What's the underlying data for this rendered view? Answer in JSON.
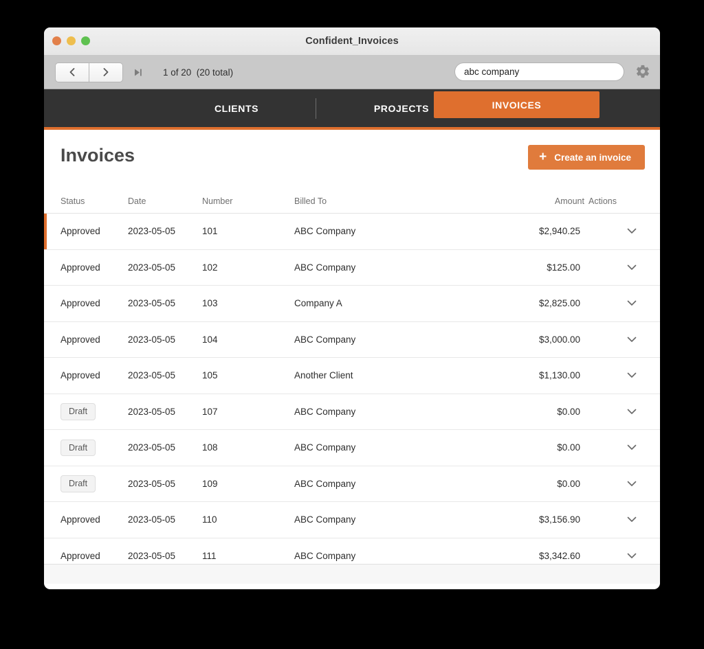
{
  "window": {
    "title": "Confident_Invoices",
    "traffic_lights": [
      {
        "name": "close",
        "color": "#e2804a"
      },
      {
        "name": "minimize",
        "color": "#eebe4e"
      },
      {
        "name": "maximize",
        "color": "#5fc150"
      }
    ]
  },
  "toolbar": {
    "back_icon": "chevron-left-icon",
    "forward_icon": "chevron-right-icon",
    "skip_icon": "skip-to-end-icon",
    "page_counter": "1 of 20  (20 total)",
    "search_value": "abc company",
    "search_placeholder": "",
    "settings_icon": "gear-icon"
  },
  "nav": {
    "tabs": [
      {
        "label": "CLIENTS",
        "active": false
      },
      {
        "label": "PROJECTS",
        "active": false
      },
      {
        "label": "INVOICES",
        "active": true
      }
    ],
    "accent_color": "#df6f2e",
    "bar_color": "#333333"
  },
  "page": {
    "title": "Invoices",
    "create_button": "Create an invoice",
    "create_icon": "plus-icon"
  },
  "table": {
    "columns": [
      "Status",
      "Date",
      "Number",
      "Billed To",
      "Amount",
      "Actions"
    ],
    "action_icon": "chevron-down-icon",
    "rows": [
      {
        "status": "Approved",
        "date": "2023-05-05",
        "number": "101",
        "billed_to": "ABC Company",
        "amount": "$2,940.25",
        "draft": false,
        "selected": true
      },
      {
        "status": "Approved",
        "date": "2023-05-05",
        "number": "102",
        "billed_to": "ABC Company",
        "amount": "$125.00",
        "draft": false,
        "selected": false
      },
      {
        "status": "Approved",
        "date": "2023-05-05",
        "number": "103",
        "billed_to": "Company A",
        "amount": "$2,825.00",
        "draft": false,
        "selected": false
      },
      {
        "status": "Approved",
        "date": "2023-05-05",
        "number": "104",
        "billed_to": "ABC Company",
        "amount": "$3,000.00",
        "draft": false,
        "selected": false
      },
      {
        "status": "Approved",
        "date": "2023-05-05",
        "number": "105",
        "billed_to": "Another Client",
        "amount": "$1,130.00",
        "draft": false,
        "selected": false
      },
      {
        "status": "Draft",
        "date": "2023-05-05",
        "number": "107",
        "billed_to": "ABC Company",
        "amount": "$0.00",
        "draft": true,
        "selected": false
      },
      {
        "status": "Draft",
        "date": "2023-05-05",
        "number": "108",
        "billed_to": "ABC Company",
        "amount": "$0.00",
        "draft": true,
        "selected": false
      },
      {
        "status": "Draft",
        "date": "2023-05-05",
        "number": "109",
        "billed_to": "ABC Company",
        "amount": "$0.00",
        "draft": true,
        "selected": false
      },
      {
        "status": "Approved",
        "date": "2023-05-05",
        "number": "110",
        "billed_to": "ABC Company",
        "amount": "$3,156.90",
        "draft": false,
        "selected": false
      },
      {
        "status": "Approved",
        "date": "2023-05-05",
        "number": "111",
        "billed_to": "ABC Company",
        "amount": "$3,342.60",
        "draft": false,
        "selected": false
      }
    ]
  }
}
